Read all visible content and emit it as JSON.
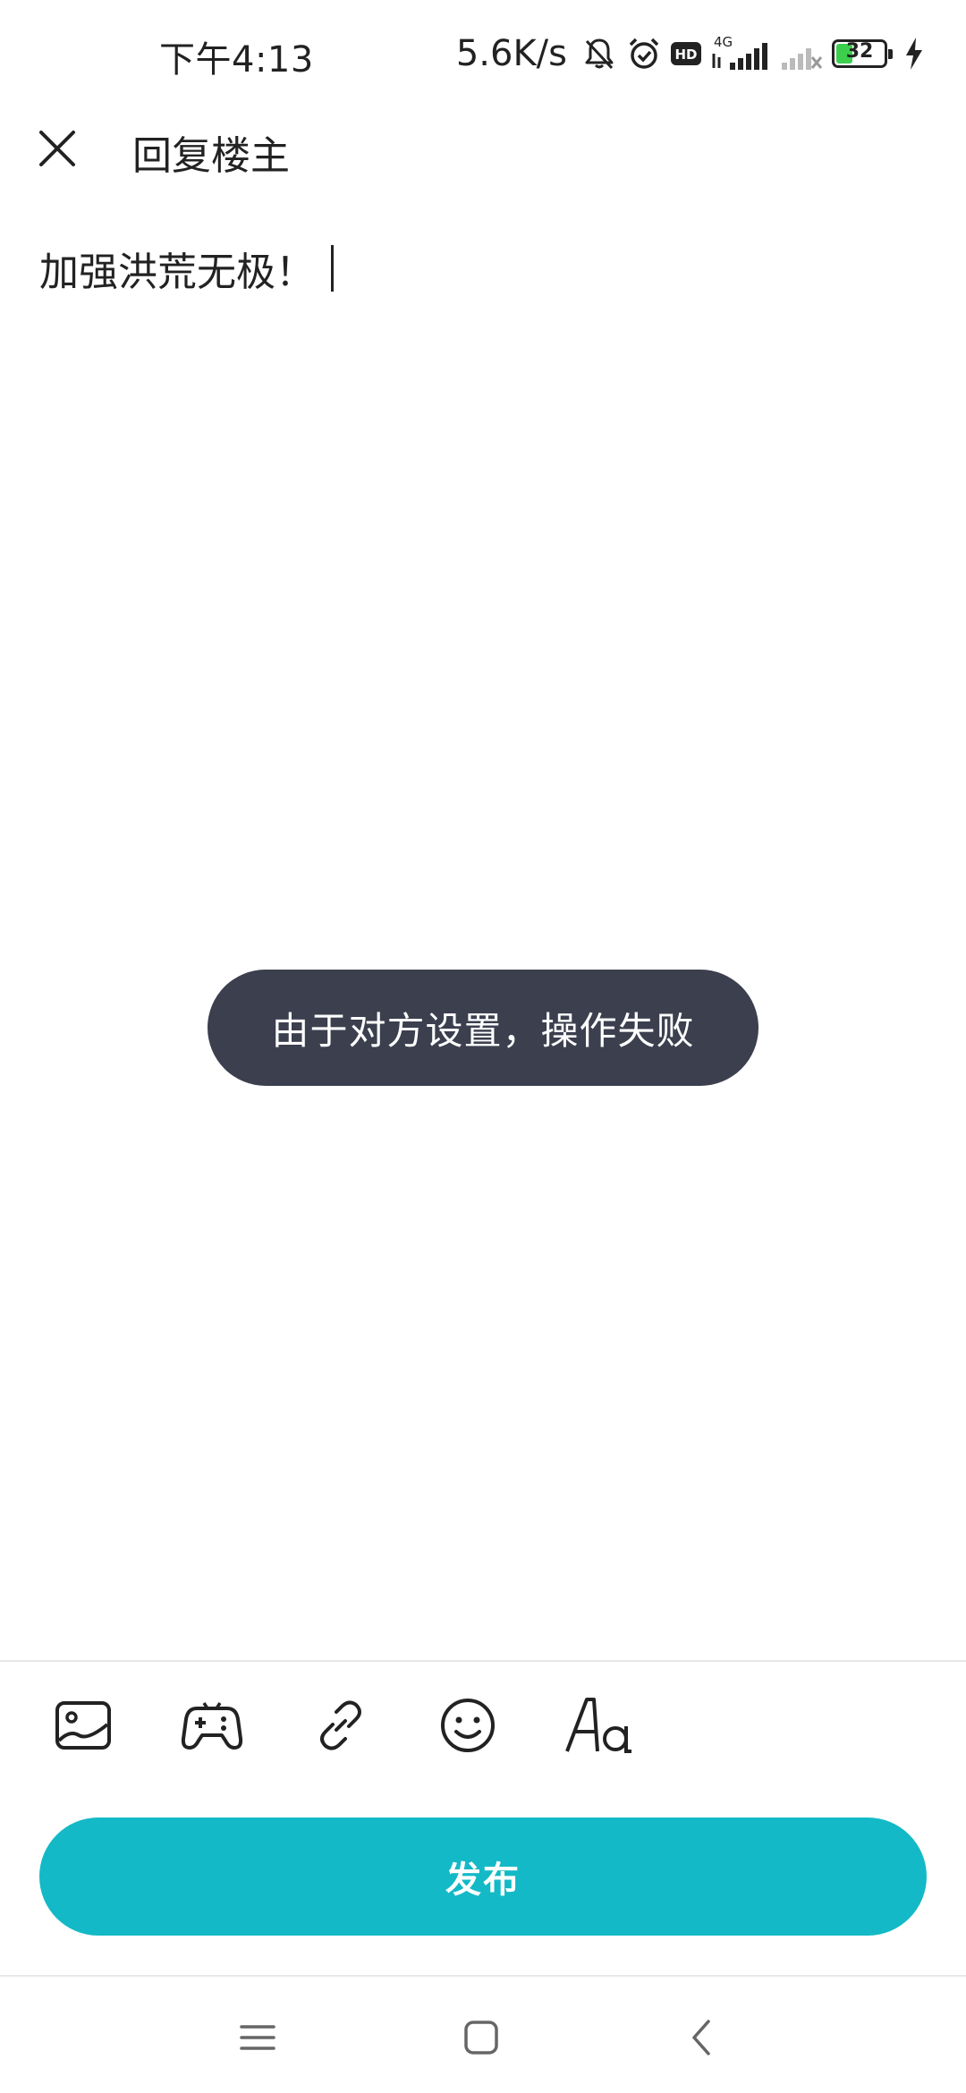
{
  "status_bar": {
    "time": "下午4:13",
    "net_speed": "5.6K/s",
    "network_label": "4G",
    "hd_label": "HD",
    "battery_level": "32",
    "icons": [
      "bell-muted-icon",
      "alarm-icon",
      "hd-icon",
      "signal-4g-icon",
      "signal-empty-icon",
      "battery-icon",
      "charging-icon"
    ]
  },
  "header": {
    "title": "回复楼主",
    "close_icon": "close-icon"
  },
  "editor": {
    "content": "加强洪荒无极！"
  },
  "toast": {
    "message": "由于对方设置，操作失败"
  },
  "toolbar": {
    "icons": [
      "image-icon",
      "gamepad-icon",
      "link-icon",
      "emoji-icon",
      "text-format-icon"
    ]
  },
  "publish": {
    "label": "发布"
  },
  "nav": {
    "icons": [
      "menu-icon",
      "home-icon",
      "back-icon"
    ]
  },
  "colors": {
    "accent": "#13b9c6",
    "toast_bg": "#3b3f4e",
    "battery_fill": "#3ccf4e"
  }
}
